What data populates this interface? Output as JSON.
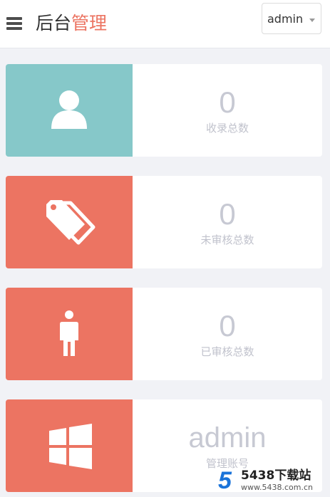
{
  "header": {
    "title_main": "后台",
    "title_accent": "管理",
    "user_menu_label": "admin"
  },
  "cards": [
    {
      "value": "0",
      "caption": "收录总数",
      "icon": "user-icon",
      "color": "#86c8c9"
    },
    {
      "value": "0",
      "caption": "未审核总数",
      "icon": "tags-icon",
      "color": "#ec7462"
    },
    {
      "value": "0",
      "caption": "已审核总数",
      "icon": "person-icon",
      "color": "#ec7462"
    },
    {
      "value": "admin",
      "caption": "管理账号",
      "icon": "windows-icon",
      "color": "#ec7462"
    }
  ],
  "watermark": {
    "logo": "5",
    "title": "5438下载站",
    "url": "www.5438.com.cn"
  }
}
